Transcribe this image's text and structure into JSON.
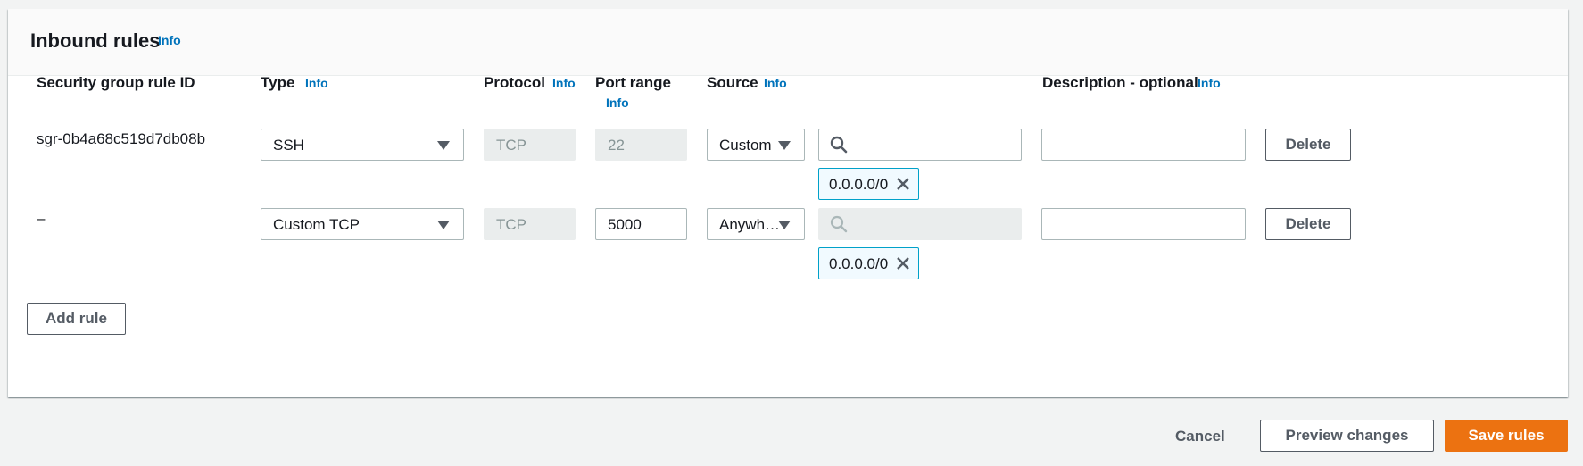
{
  "panel": {
    "title": "Inbound rules",
    "info_label": "Info"
  },
  "columns": {
    "rule_id": "Security group rule ID",
    "type": "Type",
    "protocol": "Protocol",
    "port_range": "Port range",
    "source": "Source",
    "description": "Description - optional",
    "info_label": "Info"
  },
  "rules": [
    {
      "rule_id": "sgr-0b4a68c519d7db08b",
      "type": "SSH",
      "protocol": "TCP",
      "port_range": "22",
      "port_editable": false,
      "source_type": "Custom",
      "source_search": "",
      "source_search_disabled": false,
      "source_token": "0.0.0.0/0",
      "description": "",
      "delete_label": "Delete"
    },
    {
      "rule_id": "–",
      "type": "Custom TCP",
      "protocol": "TCP",
      "port_range": "5000",
      "port_editable": true,
      "source_type": "Anywh…",
      "source_search": "",
      "source_search_disabled": true,
      "source_token": "0.0.0.0/0",
      "description": "",
      "delete_label": "Delete"
    }
  ],
  "add_rule_label": "Add rule",
  "footer": {
    "cancel_label": "Cancel",
    "preview_label": "Preview changes",
    "save_label": "Save rules"
  },
  "colors": {
    "primary": "#ec7211",
    "link": "#0073bb",
    "token_border": "#00a1c9"
  },
  "icons": {
    "search": "search-icon",
    "dismiss": "close-icon",
    "dropdown": "caret-down-icon"
  }
}
